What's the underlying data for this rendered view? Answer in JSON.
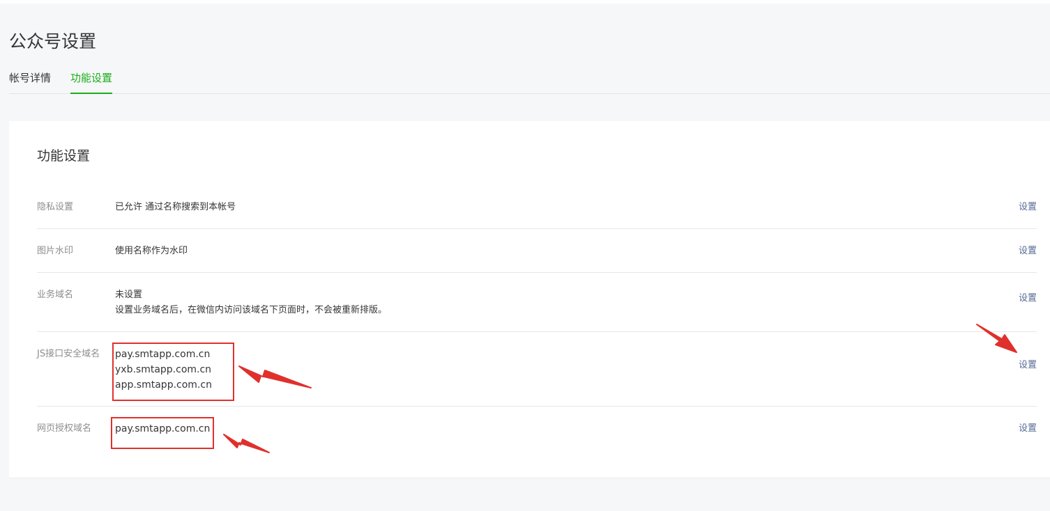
{
  "page": {
    "title": "公众号设置"
  },
  "tabs": [
    {
      "label": "帐号详情",
      "active": false
    },
    {
      "label": "功能设置",
      "active": true
    }
  ],
  "section": {
    "title": "功能设置",
    "action_label": "设置",
    "rows": [
      {
        "label": "隐私设置",
        "lines": [
          "已允许 通过名称搜索到本帐号"
        ]
      },
      {
        "label": "图片水印",
        "lines": [
          "使用名称作为水印"
        ]
      },
      {
        "label": "业务域名",
        "lines": [
          "未设置",
          "设置业务域名后，在微信内访问该域名下页面时，不会被重新排版。"
        ]
      },
      {
        "label": "JS接口安全域名",
        "lines": [
          "pay.smtapp.com.cn",
          "yxb.smtapp.com.cn",
          "app.smtapp.com.cn"
        ]
      },
      {
        "label": "网页授权域名",
        "lines": [
          "pay.smtapp.com.cn"
        ]
      }
    ]
  },
  "colors": {
    "accent_green": "#1aad19",
    "link_blue": "#576b95",
    "annotation_red": "#e0302c",
    "page_background": "#f6f7f9"
  }
}
